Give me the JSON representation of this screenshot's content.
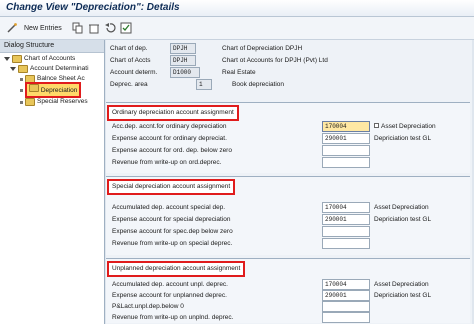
{
  "window": {
    "title": "Change View \"Depreciation\": Details"
  },
  "toolbar": {
    "new_entries_label": "New Entries"
  },
  "tree": {
    "header": "Dialog Structure",
    "items": [
      {
        "label": "Chart of Accounts"
      },
      {
        "label": "Account Determinati"
      },
      {
        "label": "Balnce Sheet Ac"
      },
      {
        "label": "Depreciation"
      },
      {
        "label": "Special Reserves"
      }
    ]
  },
  "header_fields": [
    {
      "label": "Chart of dep.",
      "value": "DPJH",
      "desc": "Chart of Depreciation DPJH"
    },
    {
      "label": "Chart of Accts",
      "value": "DPJH",
      "desc": "Chart ot Accounts for DPJH (Pvt) Ltd"
    },
    {
      "label": "Account determ.",
      "value": "D1000",
      "desc": "Real Estate"
    },
    {
      "label": "Deprec. area",
      "value": "1",
      "desc": "Book depreciation"
    }
  ],
  "groups": [
    {
      "title": "Ordinary depreciation account assignment",
      "rows": [
        {
          "label": "Acc.dep. accnt.for ordinary depreciation",
          "value": "170004",
          "desc": "Asset Depreciation"
        },
        {
          "label": "Expense account for ordinary depreciat.",
          "value": "290001",
          "desc": "Depriciation test GL"
        },
        {
          "label": "Expense account for ord. dep. below zero",
          "value": "",
          "desc": ""
        },
        {
          "label": "Revenue from write-up on ord.deprec.",
          "value": "",
          "desc": ""
        }
      ]
    },
    {
      "title": "Special depreciation account assignment",
      "rows": [
        {
          "label": "Accumulated dep. account special dep.",
          "value": "170004",
          "desc": "Asset Depreciation"
        },
        {
          "label": "Expense account for special depreciation",
          "value": "290001",
          "desc": "Depriciation test GL"
        },
        {
          "label": "Expense account for spec.dep below zero",
          "value": "",
          "desc": ""
        },
        {
          "label": "Revenue from write-up on special deprec.",
          "value": "",
          "desc": ""
        }
      ]
    },
    {
      "title": "Unplanned depreciation account assignment",
      "rows": [
        {
          "label": "Accumulated dep. account unpl. deprec.",
          "value": "170004",
          "desc": "Asset Depreciation"
        },
        {
          "label": "Expense account for unplanned deprec.",
          "value": "290001",
          "desc": "Depriciation test GL"
        },
        {
          "label": "P&Lact.unpl.dep.below 0",
          "value": "",
          "desc": ""
        },
        {
          "label": "Revenue from write-up on unplnd. deprec.",
          "value": "",
          "desc": ""
        }
      ]
    }
  ]
}
